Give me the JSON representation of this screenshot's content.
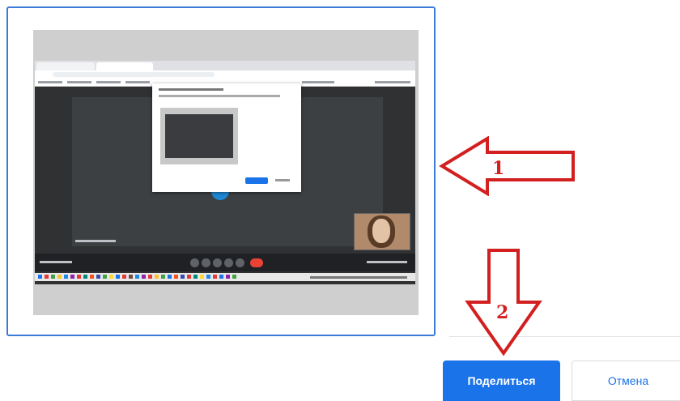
{
  "dialog": {
    "share_label": "Поделиться",
    "cancel_label": "Отмена"
  },
  "annotations": {
    "arrow1_number": "1",
    "arrow2_number": "2",
    "arrow_color": "#d21f1f"
  },
  "colors": {
    "accent": "#1a73e8",
    "selection_border": "#3b7bd8"
  }
}
